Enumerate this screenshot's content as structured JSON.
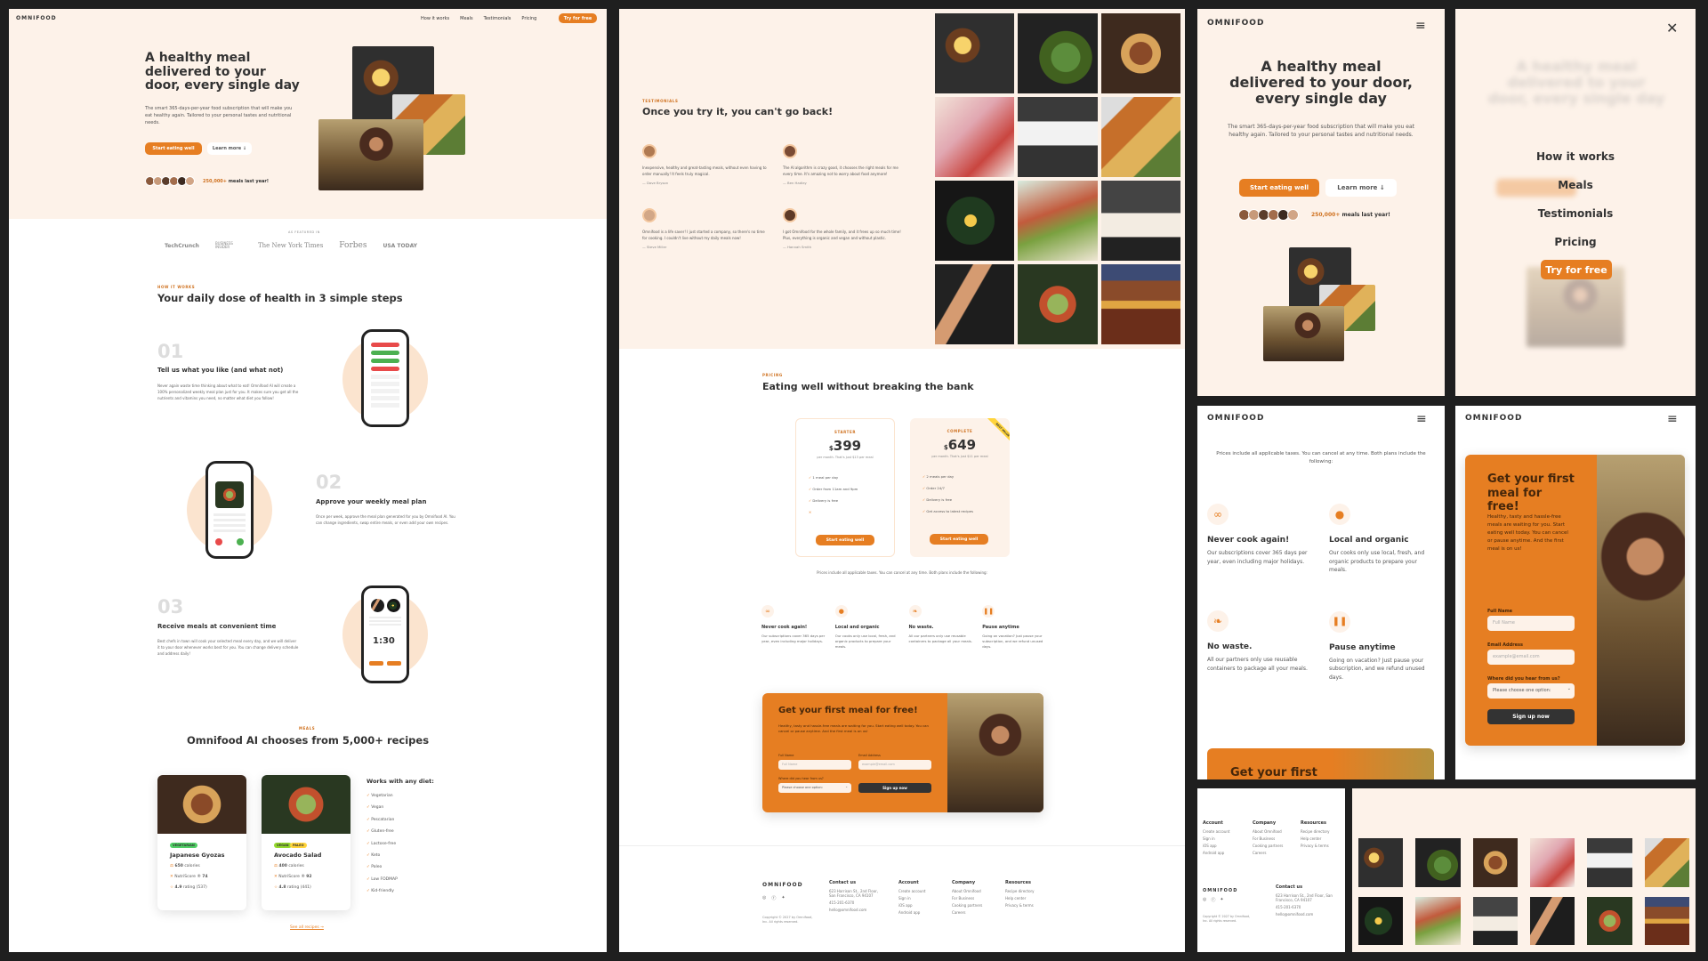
{
  "brand": {
    "logo": "OMNIFOOD",
    "accent": "#e67e22",
    "cream": "#fdf2e9"
  },
  "nav": {
    "items": [
      "How it works",
      "Meals",
      "Testimonials",
      "Pricing"
    ],
    "cta": "Try for free"
  },
  "hero": {
    "title": "A healthy meal delivered to your door, every single day",
    "text": "The smart 365-days-per-year food subscription that will make you eat healthy again. Tailored to your personal tastes and nutritional needs.",
    "btn_primary": "Start eating well",
    "btn_secondary": "Learn more ↓",
    "delivered_count": "250,000+",
    "delivered_text": "meals last year!"
  },
  "featured": {
    "label": "AS FEATURED IN",
    "logos": [
      "TechCrunch",
      "BUSINESS INSIDER",
      "The New York Times",
      "Forbes",
      "USA TODAY"
    ]
  },
  "how": {
    "subheading": "HOW IT WORKS",
    "heading": "Your daily dose of health in 3 simple steps",
    "steps": [
      {
        "num": "01",
        "title": "Tell us what you like (and what not)",
        "text": "Never again waste time thinking about what to eat! Omnifood AI will create a 100% personalized weekly meal plan just for you. It makes sure you get all the nutrients and vitamins you need, no matter what diet you follow!"
      },
      {
        "num": "02",
        "title": "Approve your weekly meal plan",
        "text": "Once per week, approve the meal plan generated for you by Omnifood AI. You can change ingredients, swap entire meals, or even add your own recipes."
      },
      {
        "num": "03",
        "title": "Receive meals at convenient time",
        "text": "Best chefs in town will cook your selected meal every day, and we will deliver it to your door whenever works best for you. You can change delivery schedule and address daily!"
      }
    ],
    "phone_time": "1:30"
  },
  "meals": {
    "subheading": "MEALS",
    "heading": "Omnifood AI chooses from 5,000+ recipes",
    "cards": [
      {
        "tags": [
          "VEGETARIAN"
        ],
        "name": "Japanese Gyozas",
        "calories": "650",
        "calories_label": "calories",
        "score_label": "NutriScore ®",
        "score": "74",
        "rating": "4.9",
        "rating_label": "rating (537)"
      },
      {
        "tags": [
          "VEGAN",
          "PALEO"
        ],
        "name": "Avocado Salad",
        "calories": "400",
        "calories_label": "calories",
        "score_label": "NutriScore ®",
        "score": "92",
        "rating": "4.8",
        "rating_label": "rating (441)"
      }
    ],
    "diets_title": "Works with any diet:",
    "diets": [
      "Vegetarian",
      "Vegan",
      "Pescatarian",
      "Gluten-free",
      "Lactose-free",
      "Keto",
      "Paleo",
      "Low FODMAP",
      "Kid-friendly"
    ],
    "all_link": "See all recipes →"
  },
  "testimonials": {
    "subheading": "TESTIMONIALS",
    "heading": "Once you try it, you can't go back!",
    "items": [
      {
        "text": "Inexpensive, healthy and great-tasting meals, without even having to order manually! It feels truly magical.",
        "name": "— Dave Bryson"
      },
      {
        "text": "The AI algorithm is crazy good, it chooses the right meals for me every time. It's amazing not to worry about food anymore!",
        "name": "— Ben Hadley"
      },
      {
        "text": "Omnifood is a life saver! I just started a company, so there's no time for cooking. I couldn't live without my daily meals now!",
        "name": "— Steve Miller"
      },
      {
        "text": "I got Omnifood for the whole family, and it frees up so much time! Plus, everything is organic and vegan and without plastic.",
        "name": "— Hannah Smith"
      }
    ]
  },
  "pricing": {
    "subheading": "PRICING",
    "heading": "Eating well without breaking the bank",
    "plans": [
      {
        "name": "STARTER",
        "currency": "$",
        "price": "399",
        "per": "per month. That's just $13 per meal",
        "features": [
          "1 meal per day",
          "Order from 11am and 9pm",
          "Delivery is free",
          ""
        ],
        "cta": "Start eating well"
      },
      {
        "name": "COMPLETE",
        "currency": "$",
        "price": "649",
        "per": "per month. That's just $11 per meal",
        "features": [
          "2 meals per day",
          "Order 24/7",
          "Delivery is free",
          "Get access to latest recipes"
        ],
        "cta": "Start eating well",
        "ribbon": "BEST VALUE"
      }
    ],
    "note": "Prices include all applicable taxes. You can cancel at any time. Both plans include the following:",
    "features": [
      {
        "title": "Never cook again!",
        "text": "Our subscriptions cover 365 days per year, even including major holidays."
      },
      {
        "title": "Local and organic",
        "text": "Our cooks only use local, fresh, and organic products to prepare your meals."
      },
      {
        "title": "No waste.",
        "text": "All our partners only use reusable containers to package all your meals."
      },
      {
        "title": "Pause anytime",
        "text": "Going on vacation? Just pause your subscription, and we refund unused days."
      }
    ]
  },
  "cta": {
    "title": "Get your first meal for free!",
    "title_cut": "Get your first",
    "text": "Healthy, tasty and hassle-free meals are waiting for you. Start eating well today. You can cancel or pause anytime. And the first meal is on us!",
    "name_label": "Full Name",
    "name_placeholder": "Full Name",
    "email_label": "Email Address",
    "email_placeholder": "example@email.com",
    "where_label": "Where did you hear from us?",
    "select_value": "Please choose one option:",
    "submit": "Sign up now"
  },
  "footer": {
    "contact_title": "Contact us",
    "address": "623 Harrison St., 2nd Floor, San Francisco, CA 94107",
    "phone": "415-201-6370",
    "email": "hello@omnifood.com",
    "copyright": "Copyright © 2027 by Omnifood, Inc. All rights reserved.",
    "account_title": "Account",
    "account": [
      "Create account",
      "Sign in",
      "iOS app",
      "Android app"
    ],
    "company_title": "Company",
    "company": [
      "About Omnifood",
      "For Business",
      "Cooking partners",
      "Careers"
    ],
    "resources_title": "Resources",
    "resources": [
      "Recipe directory",
      "Help center",
      "Privacy & terms"
    ]
  },
  "close_glyph": "✕"
}
